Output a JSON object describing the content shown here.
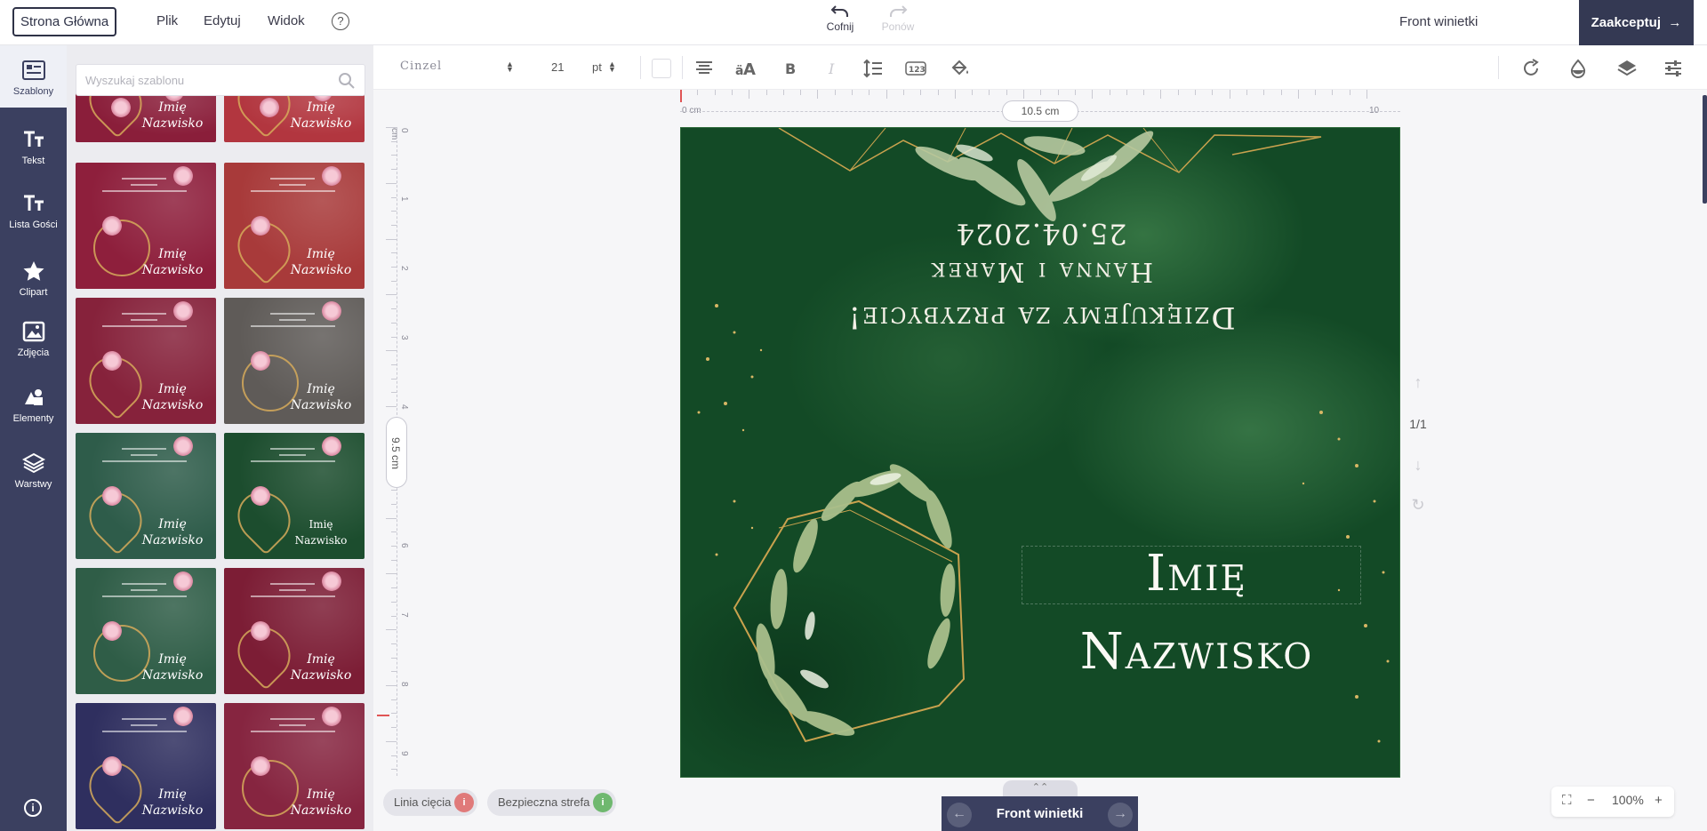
{
  "topbar": {
    "home_label": "Strona Główna",
    "menu": [
      "Plik",
      "Edytuj",
      "Widok"
    ],
    "help_glyph": "?",
    "undo_label": "Cofnij",
    "redo_label": "Ponów",
    "document_name": "Front winietki",
    "accept_label": "Zaakceptuj",
    "accent_color": "#343953"
  },
  "rail": {
    "items": [
      {
        "label": "Szablony",
        "icon": "template-icon",
        "active": true
      },
      {
        "label": "Tekst",
        "icon": "text-icon"
      },
      {
        "label": "Lista Gości",
        "icon": "guest-list-icon"
      },
      {
        "label": "Clipart",
        "icon": "star-icon"
      },
      {
        "label": "Zdjęcia",
        "icon": "image-icon"
      },
      {
        "label": "Elementy",
        "icon": "shapes-icon"
      },
      {
        "label": "Warstwy",
        "icon": "layers-icon"
      }
    ],
    "info_glyph": "i"
  },
  "panel": {
    "search_placeholder": "Wyszukaj szablonu",
    "templates": [
      {
        "name1": "Imię",
        "name2": "Nazwisko",
        "bg": "#8a1e3a",
        "style": "script"
      },
      {
        "name1": "Imię",
        "name2": "Nazwisko",
        "bg": "#b2363f",
        "style": "script"
      },
      {
        "name1": "Imię",
        "name2": "Nazwisko",
        "bg": "#8e1f3c",
        "style": "script"
      },
      {
        "name1": "Imię",
        "name2": "Nazwisko",
        "bg": "#a83a3a",
        "style": "script"
      },
      {
        "name1": "Imię",
        "name2": "Nazwisko",
        "bg": "#86223b",
        "style": "script"
      },
      {
        "name1": "Imię",
        "name2": "Nazwisko",
        "bg": "#5f5b58",
        "style": "script"
      },
      {
        "name1": "Imię",
        "name2": "Nazwisko",
        "bg": "#2e5c4a",
        "style": "script"
      },
      {
        "name1": "Imię",
        "name2": "Nazwisko",
        "bg": "#1c4d2e",
        "style": "caps"
      },
      {
        "name1": "Imię",
        "name2": "Nazwisko",
        "bg": "#2f5d47",
        "style": "script"
      },
      {
        "name1": "Imię",
        "name2": "Nazwisko",
        "bg": "#7c1d35",
        "style": "script"
      },
      {
        "name1": "Imię",
        "name2": "Nazwisko",
        "bg": "#2f2f5f",
        "style": "script"
      },
      {
        "name1": "Imię",
        "name2": "Nazwisko",
        "bg": "#862540",
        "style": "script"
      }
    ]
  },
  "toolbar": {
    "font": "Cinzel",
    "font_size": "21",
    "size_unit": "pt"
  },
  "rulers": {
    "h_start": "0 cm",
    "h_end": "10",
    "h_width": "10.5 cm",
    "v_start": "0 cm",
    "v_labels": [
      "1",
      "2",
      "3",
      "4",
      "6",
      "7",
      "8",
      "9"
    ],
    "v_height": "9.5 cm"
  },
  "card": {
    "thanks": "Dziękujemy za przybycie!",
    "couple": "Hanna i Marek",
    "date": "25.04.2024",
    "guest_first": "Imię",
    "guest_last": "Nazwisko",
    "bg_color": "#134a26",
    "gold_color": "#c9a24e"
  },
  "pager": {
    "pages": "1/1"
  },
  "footer": {
    "cut_line": "Linia cięcia",
    "safe_zone": "Bezpieczna strefa",
    "page_title": "Front winietki",
    "collapse_glyph": "⌃⌃",
    "zoom": "100%",
    "cut_color": "#e07a7a",
    "safe_color": "#6fb86f"
  }
}
